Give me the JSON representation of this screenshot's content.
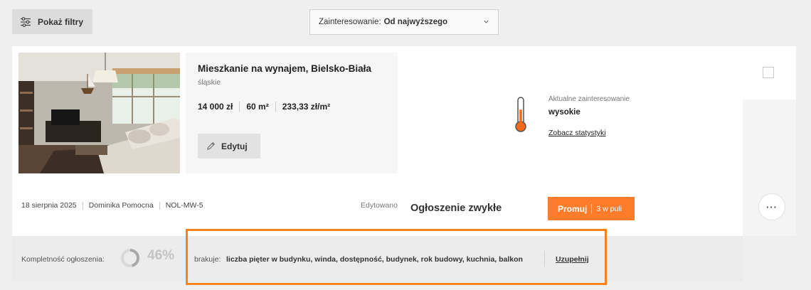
{
  "toolbar": {
    "filters_label": "Pokaż filtry",
    "sort_prefix": "Zainteresowanie:",
    "sort_value": "Od najwyższego"
  },
  "listing": {
    "title": "Mieszkanie na wynajem, Bielsko-Biała",
    "region": "śląskie",
    "price": "14 000 zł",
    "area": "60 m²",
    "price_per_m2": "233,33 zł/m²",
    "edit_label": "Edytuj",
    "interest_label": "Aktualne zainteresowanie",
    "interest_value": "wysokie",
    "interest_level": 0.6,
    "stats_link": "Zobacz statystyki",
    "date": "18 sierpnia 2025",
    "agent": "Dominika Pomocna",
    "reference": "NOL-MW-5",
    "edited_label": "Edytowano",
    "ad_type": "Ogłoszenie zwykłe",
    "promote_label": "Promuj",
    "promote_pool": "3 w puli",
    "more_label": "···"
  },
  "completeness": {
    "label": "Kompletność ogłoszenia:",
    "percent_text": "46%",
    "percent": 46,
    "missing_label": "brakuje:",
    "missing": "liczba pięter w budynku, winda, dostępność, budynek, rok budowy, kuchnia, balkon",
    "fill_link": "Uzupełnij"
  },
  "colors": {
    "accent": "#ff7c2a",
    "highlight": "#f5821f",
    "thermometer": "#f26a1b"
  },
  "icons": {
    "filters": "sliders-icon",
    "sort": "chevron-down-icon",
    "edit": "pencil-icon",
    "interest": "thermometer-icon",
    "more": "more-horizontal-icon"
  }
}
